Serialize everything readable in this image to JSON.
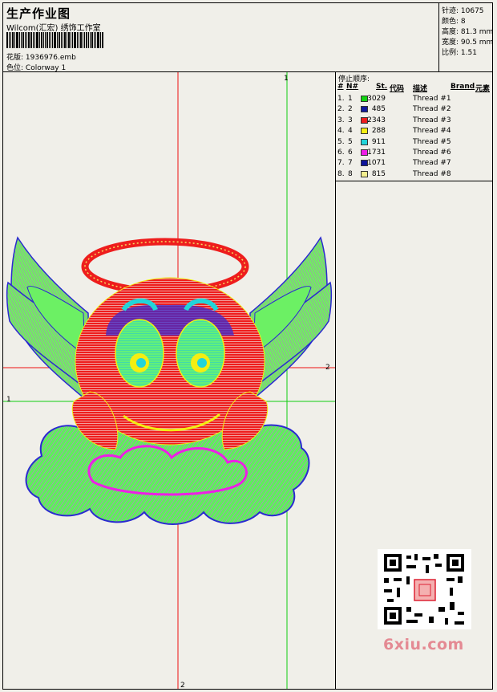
{
  "header": {
    "title": "生产作业图",
    "subtitle": "Wilcom(汇宏) 绣饰工作室",
    "design_label": "花版:",
    "design_value": "1936976.emb",
    "colorway_label": "色位:",
    "colorway_value": "Colorway 1"
  },
  "stats": {
    "stitches": "针迹: 10675",
    "colors": "颜色: 8",
    "height": "高度: 81.3 mm",
    "width": "宽度: 90.5 mm",
    "scale": "比例: 1.51"
  },
  "stop_sequence": {
    "title": "停止顺序:",
    "headers": {
      "num": "#",
      "n": "N#",
      "st": "St.",
      "code": "代码",
      "desc": "描述",
      "brand": "Brand",
      "elem": "元素"
    },
    "rows": [
      {
        "num": "1.",
        "n": "1",
        "stitches": "3029",
        "color": "#12d312",
        "desc": "Thread #1"
      },
      {
        "num": "2.",
        "n": "2",
        "stitches": "485",
        "color": "#101a9c",
        "desc": "Thread #2"
      },
      {
        "num": "3.",
        "n": "3",
        "stitches": "2343",
        "color": "#ee1d1d",
        "desc": "Thread #3"
      },
      {
        "num": "4.",
        "n": "4",
        "stitches": "288",
        "color": "#f3ee12",
        "desc": "Thread #4"
      },
      {
        "num": "5.",
        "n": "5",
        "stitches": "911",
        "color": "#22d4d9",
        "desc": "Thread #5"
      },
      {
        "num": "6.",
        "n": "6",
        "stitches": "1731",
        "color": "#ee1ee6",
        "desc": "Thread #6"
      },
      {
        "num": "7.",
        "n": "7",
        "stitches": "1071",
        "color": "#0d1399",
        "desc": "Thread #7"
      },
      {
        "num": "8.",
        "n": "8",
        "stitches": "815",
        "color": "#f3ee8e",
        "desc": "Thread #8"
      }
    ]
  },
  "guides": {
    "label_1": "1",
    "label_2": "2"
  },
  "watermark": {
    "site": "6xiu.com"
  }
}
